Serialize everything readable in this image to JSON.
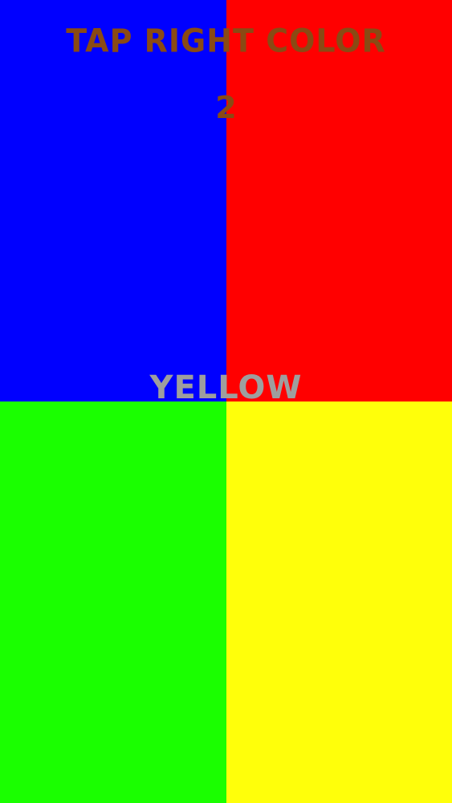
{
  "game": {
    "title": "TAP RIGHT COLOR",
    "score": "2",
    "target_word": "YELLOW"
  },
  "colors": {
    "text_title": "#8a4a14",
    "text_word": "#9e9e9e",
    "tiles": [
      {
        "name": "blue",
        "color": "#0000ff"
      },
      {
        "name": "red",
        "color": "#ff0000"
      },
      {
        "name": "green",
        "color": "#1aff00"
      },
      {
        "name": "yellow",
        "color": "#ffff0a"
      }
    ]
  }
}
